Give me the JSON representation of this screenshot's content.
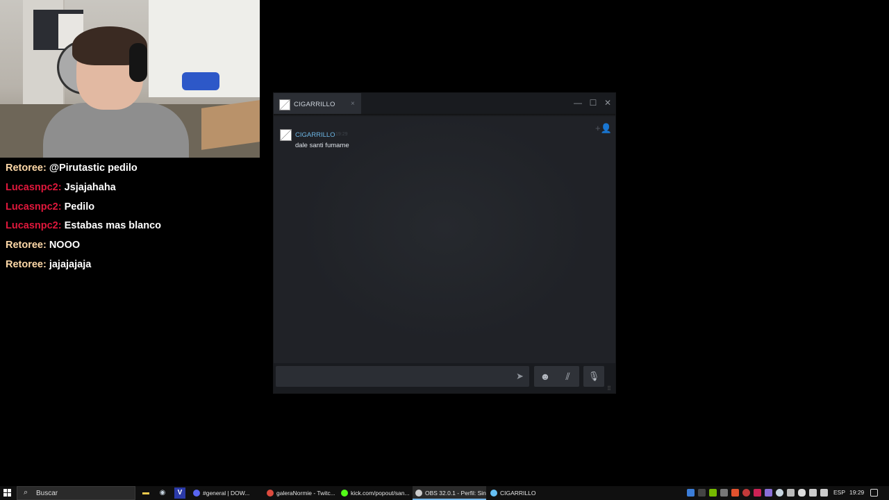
{
  "chat_overlay": {
    "messages": [
      {
        "user": "Retoree:",
        "user_color": "#ffd9a8",
        "text": "@Pirutastic pedilo"
      },
      {
        "user": "Lucasnpc2:",
        "user_color": "#e0183c",
        "text": "Jsjajahaha"
      },
      {
        "user": "Lucasnpc2:",
        "user_color": "#e0183c",
        "text": "Pedilo"
      },
      {
        "user": "Lucasnpc2:",
        "user_color": "#e0183c",
        "text": "Estabas mas blanco"
      },
      {
        "user": "Retoree:",
        "user_color": "#ffd9a8",
        "text": "NOOO"
      },
      {
        "user": "Retoree:",
        "user_color": "#ffd9a8",
        "text": "jajajajaja"
      }
    ]
  },
  "steam_chat": {
    "tab_title": "CIGARRILLO",
    "tab_close": "×",
    "window_controls": {
      "minimize": "—",
      "maximize": "☐",
      "close": "✕"
    },
    "add_friend_icon": "+👤",
    "message": {
      "author": "CIGARRILLO",
      "time": "19:29",
      "text": "dale santi fumame"
    },
    "send_icon": "➤",
    "emoji_icon": "☻",
    "attach_icon": "⫽",
    "voice_icon": "🎙",
    "resize_icon": "⠿"
  },
  "taskbar": {
    "search_placeholder": "Buscar",
    "search_icon": "⌕",
    "tasks": [
      {
        "label": "#general | DOW...",
        "icon_color": "#5865f2"
      },
      {
        "label": "galeraNormie - Twitc...",
        "icon_color": "#dd4b3e"
      },
      {
        "label": "kick.com/popout/san...",
        "icon_color": "#53fc18"
      },
      {
        "label": "OBS 32.0.1 - Perfil: Sin...",
        "icon_color": "#cccccc"
      },
      {
        "label": "CIGARRILLO",
        "icon_color": "#66c0f4"
      }
    ],
    "language": "ESP",
    "clock": "19:29"
  }
}
